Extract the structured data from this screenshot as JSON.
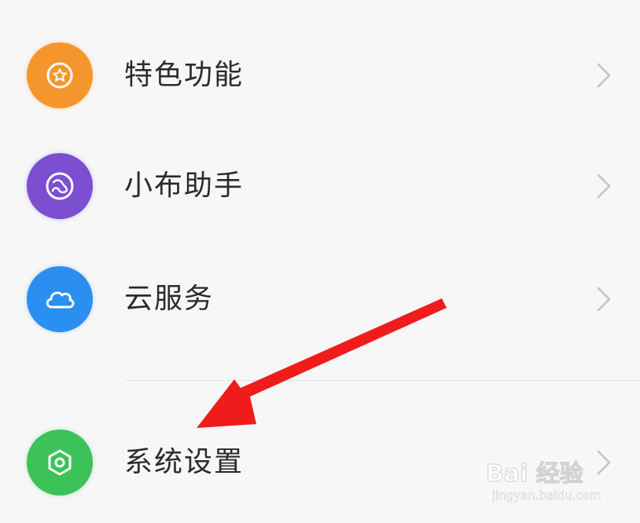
{
  "menu": {
    "items": [
      {
        "label": "特色功能",
        "icon": "star-badge-icon",
        "color": "#f5962c"
      },
      {
        "label": "小布助手",
        "icon": "assistant-icon",
        "color": "#7b4fd0"
      },
      {
        "label": "云服务",
        "icon": "cloud-icon",
        "color": "#2a8ff0"
      },
      {
        "label": "系统设置",
        "icon": "hexagon-settings-icon",
        "color": "#3dc25a"
      }
    ],
    "chevron_icon": "chevron-right-icon",
    "chevron_color": "#c4c4c4"
  },
  "annotation": {
    "arrow_color": "#f01c1c",
    "arrow_icon": "red-arrow-annotation"
  },
  "watermark": {
    "logo": "Bai 经验",
    "url": "jingyan.baidu.com"
  }
}
